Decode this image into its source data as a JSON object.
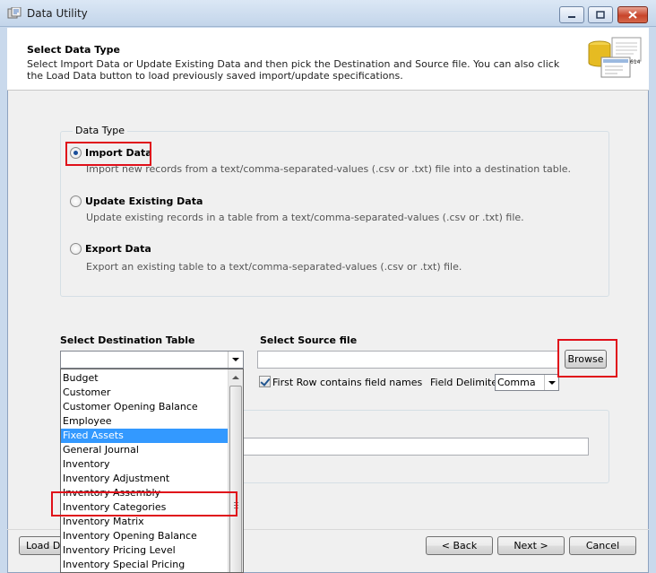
{
  "window": {
    "title": "Data Utility"
  },
  "header": {
    "title": "Select Data Type",
    "description": "Select Import Data or Update Existing Data and then pick the Destination and Source file.  You can also click the Load Data button to load previously saved import/update specifications.",
    "illustration_badge": "614"
  },
  "data_type": {
    "caption": "Data Type",
    "options": [
      {
        "label": "Import Data",
        "description": "Import new records from a text/comma-separated-values (.csv or .txt) file into a destination table.",
        "checked": true
      },
      {
        "label": "Update Existing Data",
        "description": "Update existing records in a table from a text/comma-separated-values (.csv or .txt) file.",
        "checked": false
      },
      {
        "label": "Export Data",
        "description": "Export an existing table to a text/comma-separated-values (.csv or .txt) file.",
        "checked": false
      }
    ]
  },
  "destination": {
    "label": "Select Destination Table",
    "value": "",
    "options": [
      "Budget",
      "Customer",
      "Customer Opening Balance",
      "Employee",
      "Fixed Assets",
      "General Journal",
      "Inventory",
      "Inventory Adjustment",
      "Inventory Assembly",
      "Inventory Categories",
      "Inventory Matrix",
      "Inventory Opening Balance",
      "Inventory Pricing Level",
      "Inventory Special Pricing"
    ],
    "highlighted": "Fixed Assets"
  },
  "source": {
    "label": "Select Source file",
    "value": "",
    "browse_label": "Browse",
    "first_row_label": "First Row contains field names",
    "first_row_checked": true,
    "delimiter_label": "Field Delimiter",
    "delimiter_value": "Comma"
  },
  "footer": {
    "load_label": "Load Da",
    "back_label": "< Back",
    "next_label": "Next >",
    "cancel_label": "Cancel"
  },
  "colors": {
    "highlight": "#3399ff",
    "annotation": "#e0101a",
    "radio_dot": "#1a4e9a"
  }
}
